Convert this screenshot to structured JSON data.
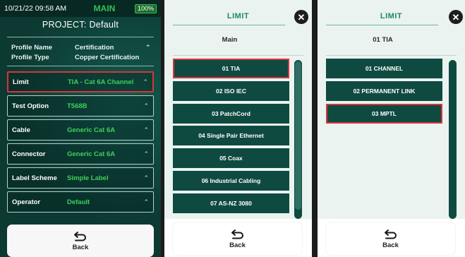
{
  "panel_main": {
    "status": {
      "time": "10/21/22 09:58 AM",
      "mode": "MAIN",
      "battery": "100%"
    },
    "project": "PROJECT: Default",
    "profile": [
      {
        "key": "Profile Name",
        "value": "Certification"
      },
      {
        "key": "Profile Type",
        "value": "Copper Certification"
      }
    ],
    "settings": [
      {
        "key": "Limit",
        "value": "TIA - Cat 6A Channel"
      },
      {
        "key": "Test Option",
        "value": "T568B"
      },
      {
        "key": "Cable",
        "value": "Generic Cat 6A"
      },
      {
        "key": "Connector",
        "value": "Generic Cat 6A"
      },
      {
        "key": "Label Scheme",
        "value": "Simple Label"
      },
      {
        "key": "Operator",
        "value": "Default"
      }
    ],
    "back_label": "Back"
  },
  "panel_limit_main": {
    "title": "LIMIT",
    "subtitle": "Main",
    "items": [
      "01 TIA",
      "02 ISO IEC",
      "03 PatchCord",
      "04 Single Pair Ethernet",
      "05 Coax",
      "06 Industrial Cabling",
      "07 AS-NZ 3080"
    ],
    "back_label": "Back"
  },
  "panel_limit_tia": {
    "title": "LIMIT",
    "subtitle": "01 TIA",
    "items": [
      "01 CHANNEL",
      "02 PERMANENT LINK",
      "03 MPTL"
    ],
    "back_label": "Back"
  },
  "colors": {
    "accent_green": "#3fcf5a",
    "teal_dark": "#0f4a40",
    "selection_red": "#d9343b",
    "title_teal": "#1a8a6a"
  },
  "icons": [
    "chevron-up-icon",
    "close-icon",
    "back-arrow-icon",
    "battery-icon"
  ]
}
